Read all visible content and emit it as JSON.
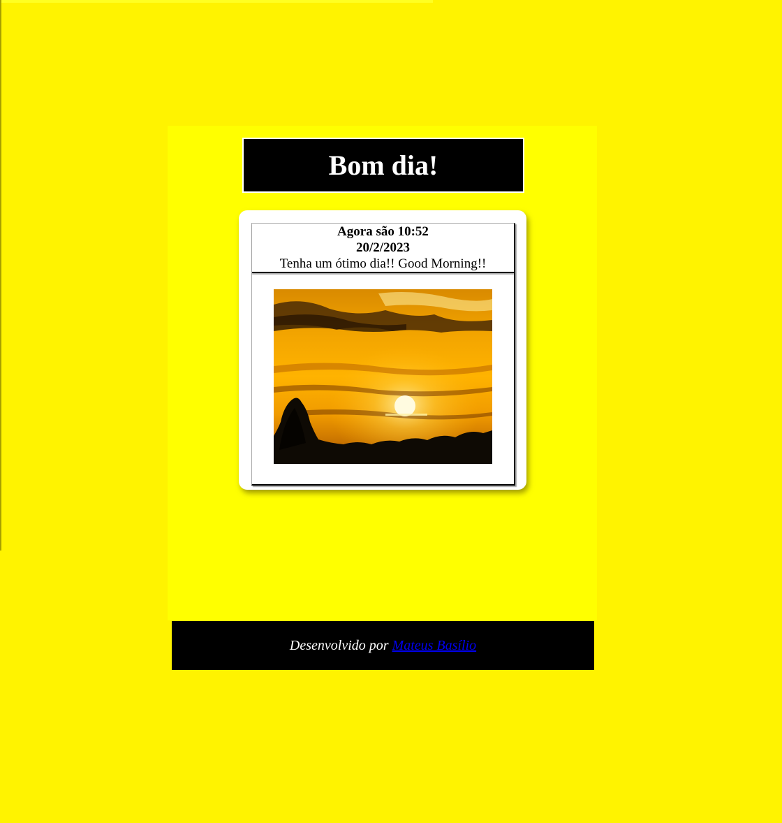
{
  "header": {
    "title": "Bom dia!"
  },
  "message": {
    "time_text": "Agora são 10:52",
    "date_text": "20/2/2023",
    "greeting_text": "Tenha um ótimo dia!! Good Morning!!"
  },
  "image": {
    "subject": "sunrise-photo"
  },
  "footer": {
    "prefix": "Desenvolvido por",
    "author_link": "Mateus Basílio"
  },
  "colors": {
    "page_background": "#fff300",
    "section_background": "#ffff00",
    "header_background": "#000000",
    "footer_background": "#000000",
    "link": "#0000ee"
  }
}
